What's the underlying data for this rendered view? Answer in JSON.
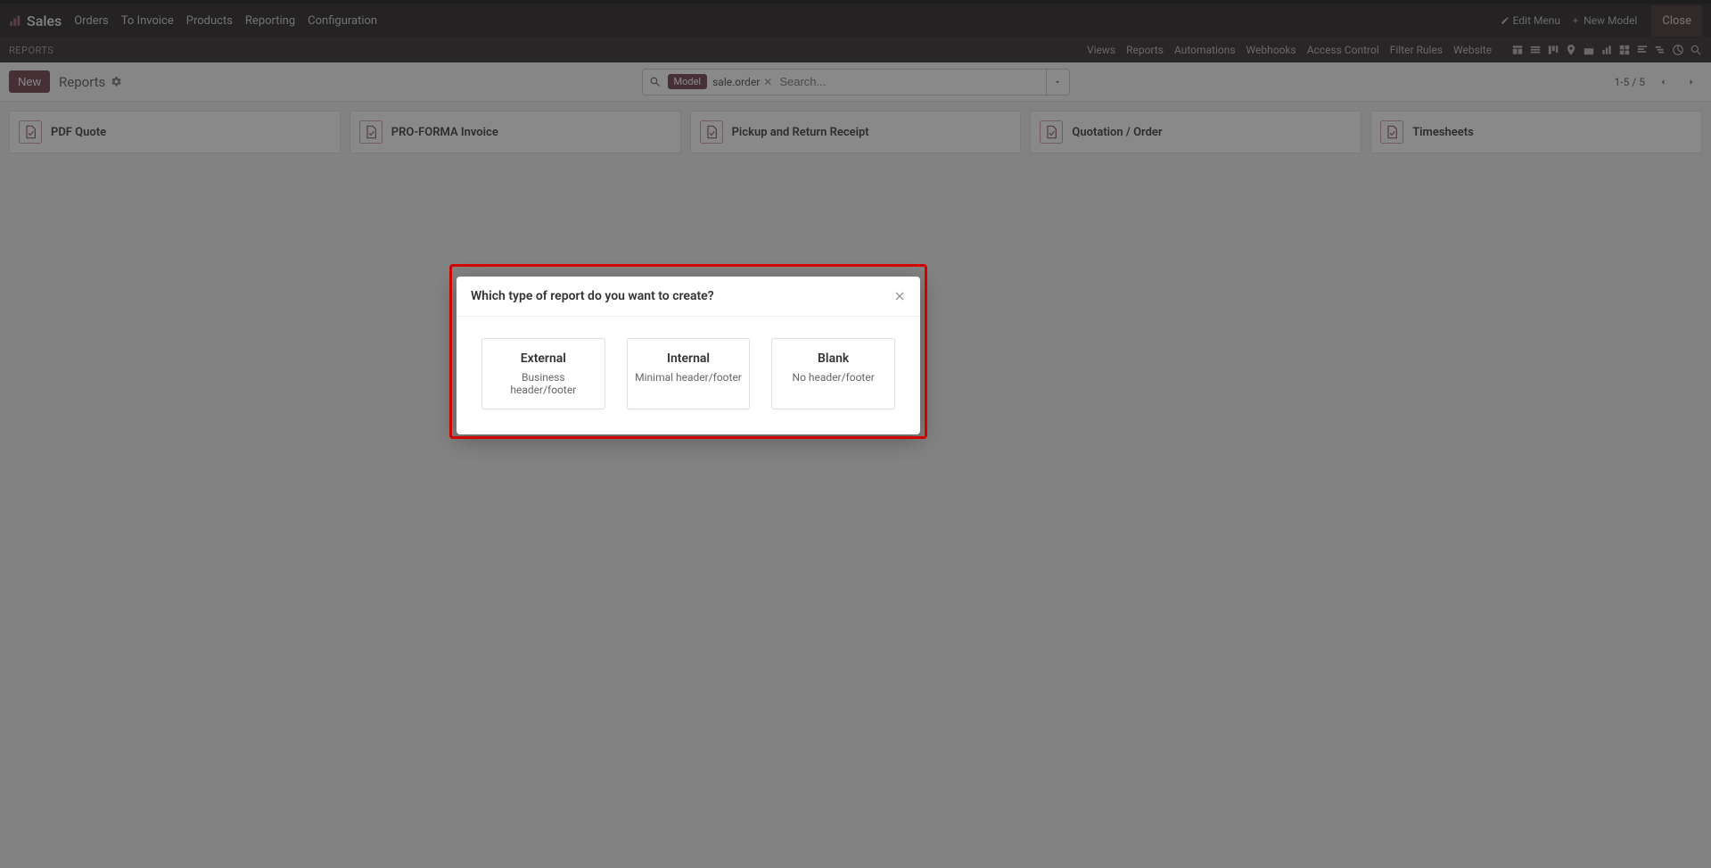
{
  "nav": {
    "brand": "Sales",
    "items": [
      "Orders",
      "To Invoice",
      "Products",
      "Reporting",
      "Configuration"
    ],
    "edit_menu": "Edit Menu",
    "new_model": "New Model",
    "close": "Close"
  },
  "subnav": {
    "crumb": "REPORTS",
    "links": [
      "Views",
      "Reports",
      "Automations",
      "Webhooks",
      "Access Control",
      "Filter Rules",
      "Website"
    ]
  },
  "control": {
    "new": "New",
    "breadcrumb": "Reports",
    "search": {
      "facet_label": "Model",
      "facet_value": "sale.order",
      "placeholder": "Search..."
    },
    "pager": "1-5 / 5"
  },
  "cards": [
    "PDF Quote",
    "PRO-FORMA Invoice",
    "Pickup and Return Receipt",
    "Quotation / Order",
    "Timesheets"
  ],
  "modal": {
    "title": "Which type of report do you want to create?",
    "options": [
      {
        "title": "External",
        "desc": "Business header/footer"
      },
      {
        "title": "Internal",
        "desc": "Minimal header/footer"
      },
      {
        "title": "Blank",
        "desc": "No header/footer"
      }
    ]
  }
}
